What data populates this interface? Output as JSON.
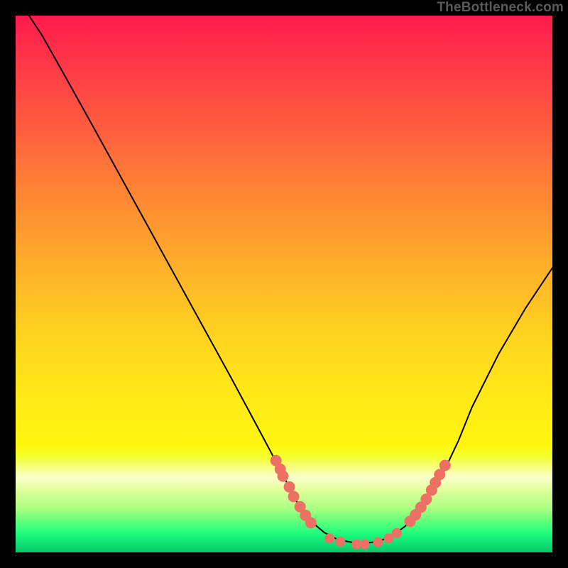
{
  "watermark": {
    "text": "TheBottleneck.com"
  },
  "colors": {
    "curve": "#000000",
    "marker": "#ec7063",
    "background_top": "#ff1a4d",
    "background_bottom": "#09c466"
  },
  "chart_data": {
    "type": "line",
    "title": "",
    "xlabel": "",
    "ylabel": "",
    "xlim": [
      0,
      100
    ],
    "ylim": [
      0,
      100
    ],
    "series": [
      {
        "name": "curve",
        "stroke": "#000000",
        "points": [
          {
            "x": 2.5,
            "y": 100.0
          },
          {
            "x": 5.0,
            "y": 96.2
          },
          {
            "x": 10.0,
            "y": 87.3
          },
          {
            "x": 15.0,
            "y": 78.3
          },
          {
            "x": 20.0,
            "y": 69.2
          },
          {
            "x": 25.0,
            "y": 60.1
          },
          {
            "x": 30.0,
            "y": 51.0
          },
          {
            "x": 35.0,
            "y": 41.9
          },
          {
            "x": 40.0,
            "y": 32.8
          },
          {
            "x": 45.0,
            "y": 23.5
          },
          {
            "x": 47.5,
            "y": 18.8
          },
          {
            "x": 50.0,
            "y": 14.0
          },
          {
            "x": 52.5,
            "y": 9.2
          },
          {
            "x": 55.0,
            "y": 5.8
          },
          {
            "x": 57.5,
            "y": 3.7
          },
          {
            "x": 60.0,
            "y": 2.4
          },
          {
            "x": 62.5,
            "y": 1.9
          },
          {
            "x": 65.0,
            "y": 1.7
          },
          {
            "x": 67.5,
            "y": 2.0
          },
          {
            "x": 70.0,
            "y": 3.0
          },
          {
            "x": 72.5,
            "y": 4.8
          },
          {
            "x": 75.0,
            "y": 7.4
          },
          {
            "x": 77.5,
            "y": 11.0
          },
          {
            "x": 80.0,
            "y": 15.5
          },
          {
            "x": 82.5,
            "y": 20.8
          },
          {
            "x": 85.0,
            "y": 27.0
          },
          {
            "x": 90.0,
            "y": 37.0
          },
          {
            "x": 95.0,
            "y": 45.5
          },
          {
            "x": 100.0,
            "y": 53.0
          }
        ]
      }
    ],
    "markers_left": [
      {
        "x": 48.5,
        "y": 17.1
      },
      {
        "x": 49.3,
        "y": 15.5
      },
      {
        "x": 49.8,
        "y": 14.2
      },
      {
        "x": 51.0,
        "y": 12.2
      },
      {
        "x": 51.8,
        "y": 10.4
      },
      {
        "x": 53.0,
        "y": 8.5
      },
      {
        "x": 54.0,
        "y": 6.9
      },
      {
        "x": 55.0,
        "y": 5.5
      }
    ],
    "markers_bottom": [
      {
        "x": 58.5,
        "y": 2.6
      },
      {
        "x": 60.5,
        "y": 2.0
      },
      {
        "x": 63.5,
        "y": 1.5
      },
      {
        "x": 65.0,
        "y": 1.5
      },
      {
        "x": 67.5,
        "y": 1.9
      },
      {
        "x": 69.5,
        "y": 2.6
      },
      {
        "x": 71.0,
        "y": 3.6
      }
    ],
    "markers_right": [
      {
        "x": 73.5,
        "y": 5.8
      },
      {
        "x": 74.5,
        "y": 7.0
      },
      {
        "x": 75.5,
        "y": 8.4
      },
      {
        "x": 76.5,
        "y": 9.9
      },
      {
        "x": 77.5,
        "y": 11.6
      },
      {
        "x": 78.2,
        "y": 13.0
      },
      {
        "x": 79.0,
        "y": 14.5
      },
      {
        "x": 80.0,
        "y": 16.2
      }
    ],
    "marker_style": {
      "fill": "#ec7063",
      "radius_bottom": 7,
      "radius_side": 8
    }
  }
}
